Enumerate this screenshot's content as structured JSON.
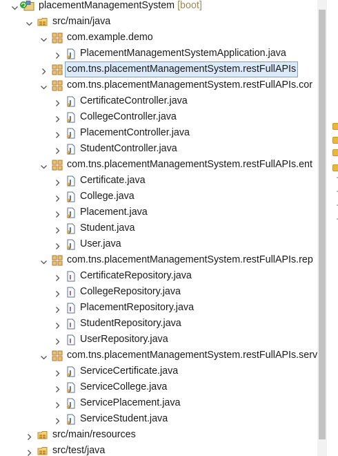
{
  "project": {
    "name": "placementManagementSystem",
    "decoration": "[boot]"
  },
  "source_folders": [
    {
      "label": "src/main/java",
      "expanded": true,
      "packages": [
        {
          "label": "com.example.demo",
          "files": [
            {
              "label": "PlacementManagementSystemApplication.java",
              "kind": "java-class-file"
            }
          ]
        },
        {
          "label": "com.tns.placementManagementSystem.restFullAPIs",
          "selected": true,
          "files": []
        },
        {
          "label": "com.tns.placementManagementSystem.restFullAPIs.cor",
          "files": [
            {
              "label": "CertificateController.java",
              "kind": "java-class-file"
            },
            {
              "label": "CollegeController.java",
              "kind": "java-class-file"
            },
            {
              "label": "PlacementController.java",
              "kind": "java-class-file"
            },
            {
              "label": "StudentController.java",
              "kind": "java-class-file"
            }
          ]
        },
        {
          "label": "com.tns.placementManagementSystem.restFullAPIs.ent",
          "files": [
            {
              "label": "Certificate.java",
              "kind": "java-class-file"
            },
            {
              "label": "College.java",
              "kind": "java-class-file"
            },
            {
              "label": "Placement.java",
              "kind": "java-class-file"
            },
            {
              "label": "Student.java",
              "kind": "java-class-file"
            },
            {
              "label": "User.java",
              "kind": "java-class-file"
            }
          ]
        },
        {
          "label": "com.tns.placementManagementSystem.restFullAPIs.rep",
          "files": [
            {
              "label": "CertificateRepository.java",
              "kind": "java-interface-file"
            },
            {
              "label": "CollegeRepository.java",
              "kind": "java-interface-file"
            },
            {
              "label": "PlacementRepository.java",
              "kind": "java-interface-file"
            },
            {
              "label": "StudentRepository.java",
              "kind": "java-interface-file"
            },
            {
              "label": "UserRepository.java",
              "kind": "java-interface-file"
            }
          ]
        },
        {
          "label": "com.tns.placementManagementSystem.restFullAPIs.serv",
          "files": [
            {
              "label": "ServiceCertificate.java",
              "kind": "java-class-file"
            },
            {
              "label": "ServiceCollege.java",
              "kind": "java-class-file"
            },
            {
              "label": "ServicePlacement.java",
              "kind": "java-class-file"
            },
            {
              "label": "ServiceStudent.java",
              "kind": "java-class-file"
            }
          ]
        }
      ]
    },
    {
      "label": "src/main/resources",
      "expanded": false,
      "packages": []
    },
    {
      "label": "src/test/java",
      "expanded": false,
      "packages": []
    }
  ],
  "colors": {
    "selection_bg": "#dbe9f8",
    "selection_border": "#7da2ce",
    "decoration_text": "#9a8a58",
    "package_icon": "#b07a2a",
    "java_file_icon": "#5a6e96",
    "interface_icon": "#7b52a6",
    "sync_badge": "#2fa32f"
  }
}
